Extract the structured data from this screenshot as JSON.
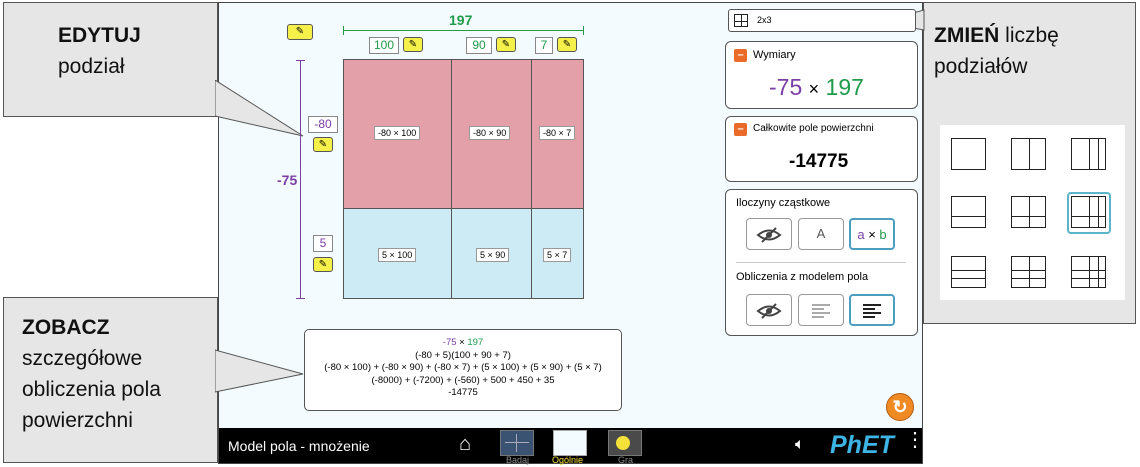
{
  "callouts": {
    "edit": {
      "bold": "EDYTUJ",
      "text": "podział"
    },
    "change": {
      "bold": "ZMIEŃ",
      "text1": "liczbę",
      "text2": "podziałów"
    },
    "view": {
      "bold": "ZOBACZ",
      "lines": [
        "szczegółowe",
        "obliczenia pola",
        "powierzchni"
      ]
    }
  },
  "area_model": {
    "top_total": "197",
    "top_parts": [
      "100",
      "90",
      "7"
    ],
    "left_total": "-75",
    "left_parts": [
      "-80",
      "5"
    ],
    "cells_row1": [
      "-80 × 100",
      "-80 × 90",
      "-80 × 7"
    ],
    "cells_row2": [
      "5 × 100",
      "5 × 90",
      "5 × 7"
    ],
    "colors": {
      "top_row": "#e3a0a8",
      "bottom_row": "#cdebf5",
      "green": "#1f9b4a",
      "purple": "#7a3fa5"
    }
  },
  "calculation": {
    "line1_a": "-75",
    "line1_op": " × ",
    "line1_b": "197",
    "line2": "(-80 + 5)(100 + 90 + 7)",
    "line3": "(-80 × 100) + (-80 × 90) + (-80 × 7) + (5 × 100) + (5 × 90) + (5 × 7)",
    "line4": "(-8000) + (-7200) + (-560) + 500 + 450 + 35",
    "line5": "-14775"
  },
  "layout_selector": {
    "value": "2x3"
  },
  "dimensions_panel": {
    "title": "Wymiary",
    "left": "-75",
    "op": "×",
    "right": "197"
  },
  "area_panel": {
    "title": "Całkowite pole powierzchni",
    "value": "-14775"
  },
  "partial_panel": {
    "title": "Iloczyny cząstkowe",
    "btn_a": "A",
    "btn_ab_a": "a",
    "btn_ab_op": "×",
    "btn_ab_b": "b",
    "calc_title": "Obliczenia z modelem pola"
  },
  "navbar": {
    "title": "Model pola - mnożenie",
    "screens": [
      "Badaj",
      "Ogólnie",
      "Gra"
    ],
    "active_screen": "Ogólnie",
    "brand": "PhET"
  }
}
